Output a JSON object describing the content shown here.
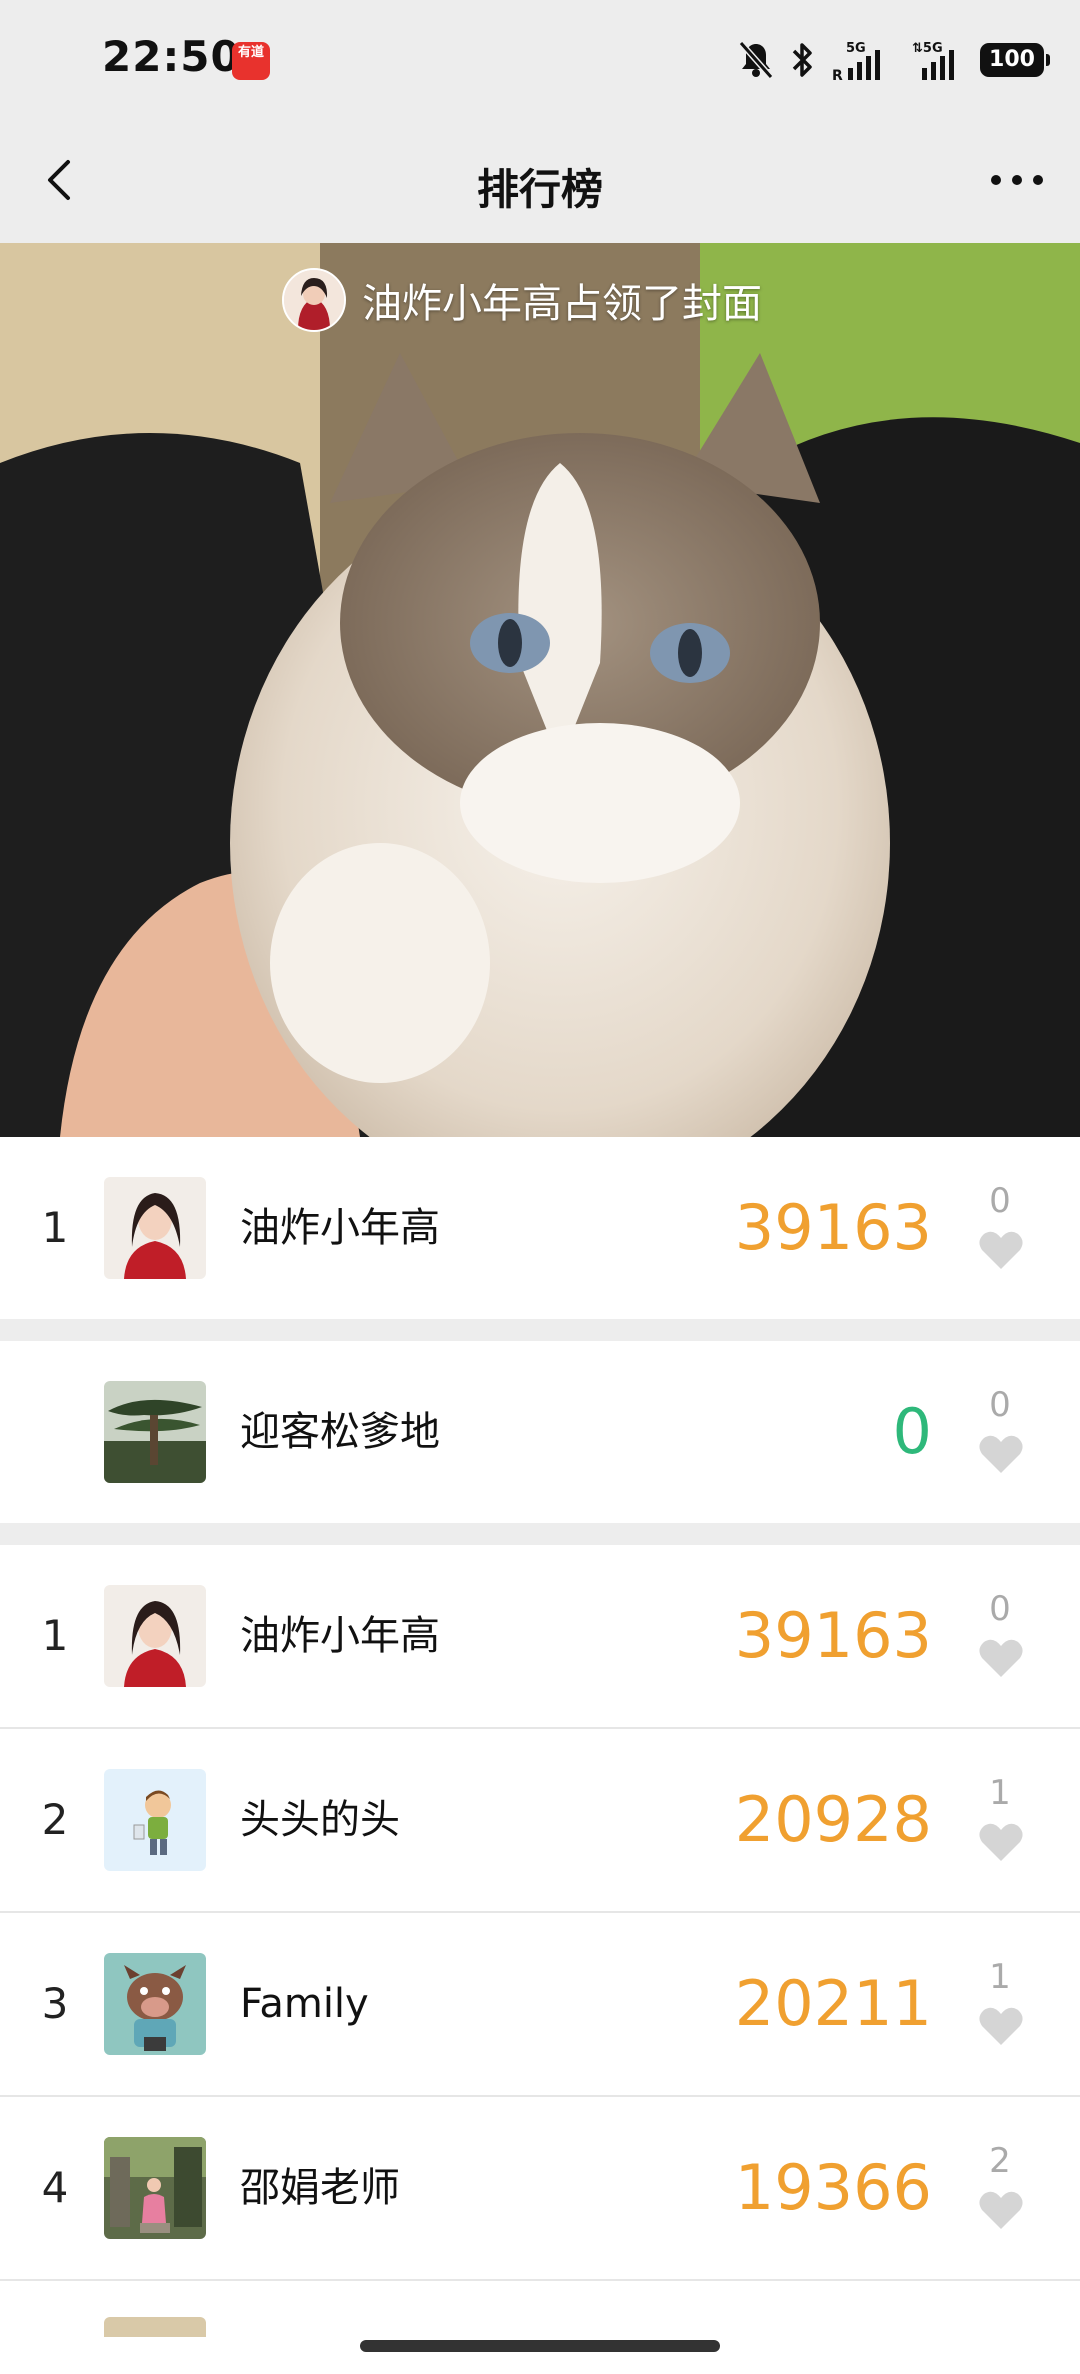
{
  "status_bar": {
    "time": "22:50",
    "app_badge": "有道",
    "battery": "100"
  },
  "nav": {
    "title": "排行榜"
  },
  "cover": {
    "caption": "油炸小年高占领了封面"
  },
  "colors": {
    "score": "#f0a030",
    "score_zero": "#2eb87a",
    "bg_gray": "#ededed"
  },
  "my_rank": {
    "rank": "1",
    "name": "油炸小年高",
    "score": "39163",
    "likes": "0"
  },
  "my_self": {
    "rank": "",
    "name": "迎客松爹地",
    "score": "0",
    "likes": "0"
  },
  "ranking": [
    {
      "rank": "1",
      "name": "油炸小年高",
      "score": "39163",
      "likes": "0",
      "avatar": "girl-avatar"
    },
    {
      "rank": "2",
      "name": "头头的头",
      "score": "20928",
      "likes": "1",
      "avatar": "cartoon-boy-avatar"
    },
    {
      "rank": "3",
      "name": "Family",
      "score": "20211",
      "likes": "1",
      "avatar": "cartoon-boar-avatar"
    },
    {
      "rank": "4",
      "name": "邵娟老师",
      "score": "19366",
      "likes": "2",
      "avatar": "photo-avatar"
    }
  ]
}
